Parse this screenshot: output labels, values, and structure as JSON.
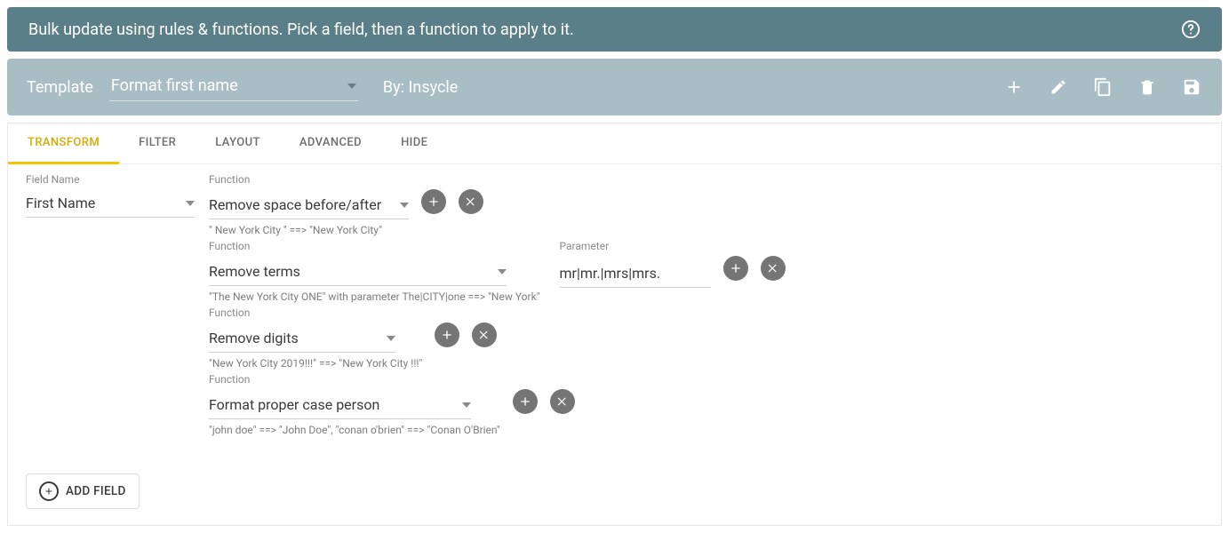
{
  "banner": {
    "text": "Bulk update using rules & functions. Pick a field, then a function to apply to it."
  },
  "toolbar": {
    "template_label": "Template",
    "template_value": "Format first name",
    "by_text": "By: Insycle"
  },
  "tabs": {
    "transform": "TRANSFORM",
    "filter": "FILTER",
    "layout": "LAYOUT",
    "advanced": "ADVANCED",
    "hide": "HIDE"
  },
  "labels": {
    "field_name": "Field Name",
    "function": "Function",
    "parameter": "Parameter",
    "add_field": "ADD FIELD"
  },
  "field": {
    "value": "First Name"
  },
  "functions": [
    {
      "value": "Remove space before/after",
      "example": "\" New York City \" ==> \"New York City\""
    },
    {
      "value": "Remove terms",
      "example": "\"The New York City ONE\" with parameter The|CITY|one ==> \"New York\"",
      "parameter": "mr|mr.|mrs|mrs."
    },
    {
      "value": "Remove digits",
      "example": "\"New York City 2019!!!\" ==> \"New York City !!!\""
    },
    {
      "value": "Format proper case person",
      "example": "\"john doe\" ==> \"John Doe\", \"conan o'brien\" ==> \"Conan O'Brien\""
    }
  ]
}
